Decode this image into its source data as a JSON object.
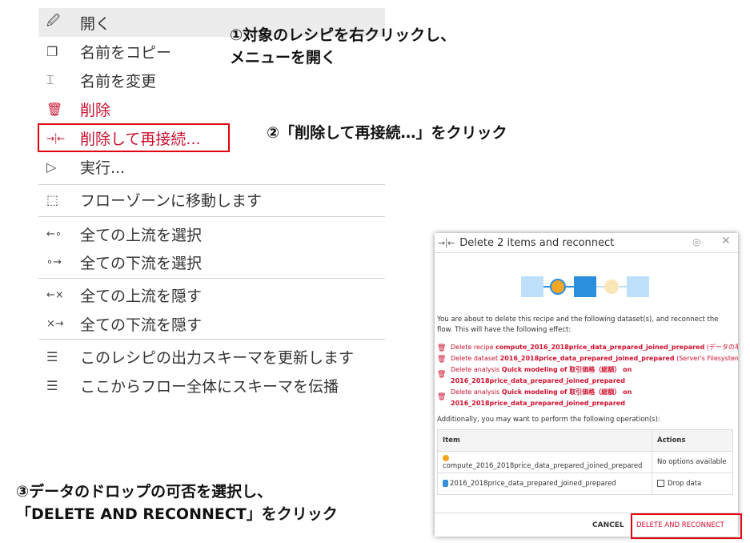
{
  "menu": {
    "items": [
      {
        "icon": "edit-icon",
        "label": "開く"
      },
      {
        "icon": "copy-icon",
        "label": "名前をコピー"
      },
      {
        "icon": "rename-icon",
        "label": "名前を変更"
      },
      {
        "icon": "trash-icon",
        "label": "削除"
      },
      {
        "icon": "delete-reconnect-icon",
        "label": "削除して再接続..."
      },
      {
        "icon": "play-icon",
        "label": "実行..."
      },
      {
        "icon": "flow-zone-icon",
        "label": "フローゾーンに移動します"
      },
      {
        "icon": "select-upstream-icon",
        "label": "全ての上流を選択"
      },
      {
        "icon": "select-downstream-icon",
        "label": "全ての下流を選択"
      },
      {
        "icon": "hide-upstream-icon",
        "label": "全ての上流を隠す"
      },
      {
        "icon": "hide-downstream-icon",
        "label": "全ての下流を隠す"
      },
      {
        "icon": "list-icon",
        "label": "このレシピの出力スキーマを更新します"
      },
      {
        "icon": "list-icon",
        "label": "ここからフロー全体にスキーマを伝播"
      }
    ]
  },
  "annotations": {
    "step1": "①対象のレシピを右クリックし、\nメニューを開く",
    "step2": "②「削除して再接続…」をクリック",
    "step3": "③データのドロップの可否を選択し、\n「DELETE AND RECONNECT」をクリック"
  },
  "dialog": {
    "title": "Delete 2 items and reconnect",
    "description": "You are about to delete this recipe and the following dataset(s), and reconnect the flow. This will have the following effect:",
    "deletions": [
      {
        "prefix": "Delete recipe ",
        "name": "compute_2016_2018price_data_prepared_joined_prepared",
        "suffix": " (データの準備)"
      },
      {
        "prefix": "Delete dataset ",
        "name": "2016_2018price_data_prepared_joined_prepared",
        "suffix": " (Server's Filesystem)"
      },
      {
        "prefix": "Delete analysis ",
        "name": "Quick modeling of 取引価格（総額） on",
        "name2": "2016_2018price_data_prepared_joined_prepared",
        "suffix": ""
      },
      {
        "prefix": "Delete analysis ",
        "name": "Quick modeling of 取引価格（総額） on",
        "name2": "2016_2018price_data_prepared_joined_prepared",
        "suffix": ""
      }
    ],
    "additional": "Additionally, you may want to perform the following operation(s):",
    "table": {
      "headers": [
        "Item",
        "Actions"
      ],
      "rows": [
        {
          "icon": "recipe-dot-icon",
          "item": "compute_2016_2018price_data_prepared_joined_prepared",
          "action": "No options available"
        },
        {
          "icon": "dataset-icon",
          "item": "2016_2018price_data_prepared_joined_prepared",
          "action": "Drop data"
        }
      ]
    },
    "cancel_label": "CANCEL",
    "confirm_label": "DELETE AND RECONNECT"
  },
  "colors": {
    "accent_red": "#c8102e",
    "highlight_box": "#e0000f",
    "flow_blue": "#2b8fe0",
    "flow_light_blue": "#bfe0fb",
    "flow_orange": "#f5a623"
  }
}
